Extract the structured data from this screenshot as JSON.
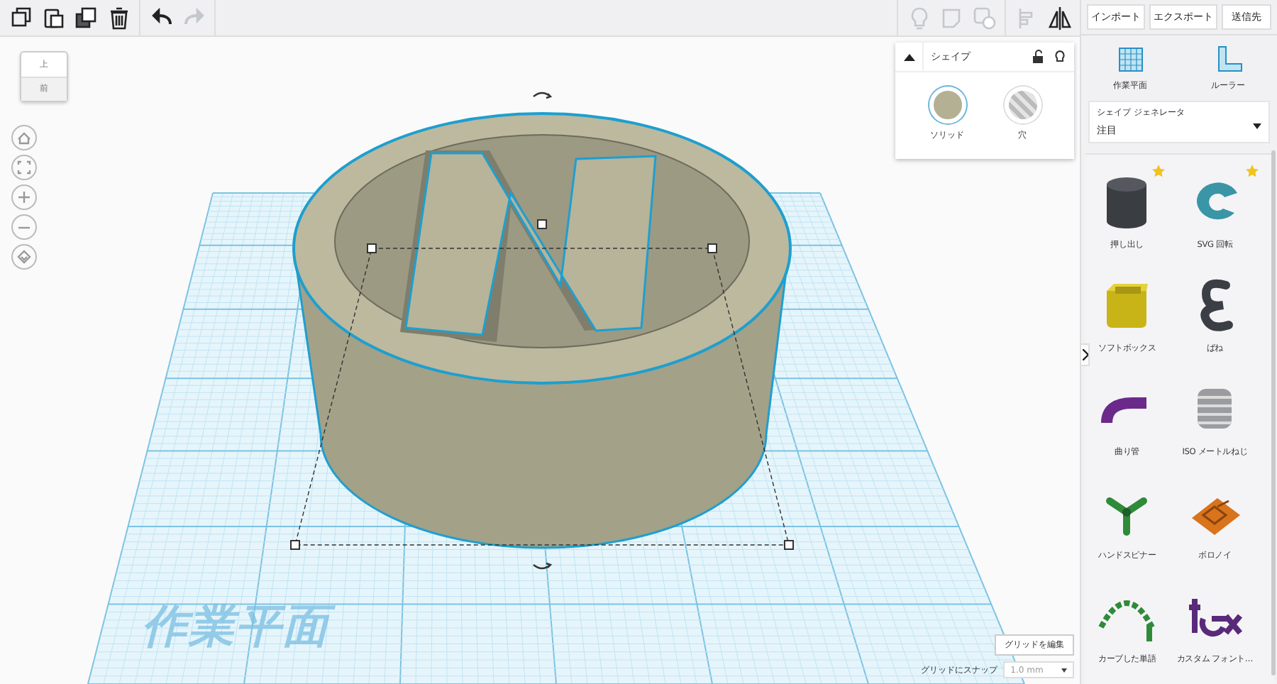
{
  "toolbar": {
    "left_tools": [
      {
        "kind": "copy",
        "disabled": false
      },
      {
        "kind": "paste",
        "disabled": false
      },
      {
        "kind": "duplicate",
        "disabled": false
      },
      {
        "kind": "delete",
        "disabled": false
      },
      {
        "kind": "undo",
        "disabled": false
      },
      {
        "kind": "redo",
        "disabled": true
      }
    ],
    "right_tools": [
      {
        "kind": "bulb",
        "disabled": true
      },
      {
        "kind": "note",
        "disabled": true
      },
      {
        "kind": "group",
        "disabled": true
      },
      {
        "kind": "align",
        "disabled": true
      },
      {
        "kind": "mirror",
        "disabled": false
      }
    ]
  },
  "header_buttons": [
    "インポート",
    "エクスポート",
    "送信先"
  ],
  "view_cube": {
    "top": "上",
    "front": "前"
  },
  "view_controls": [
    {
      "kind": "home"
    },
    {
      "kind": "fit"
    },
    {
      "kind": "zoom_in"
    },
    {
      "kind": "zoom_out"
    },
    {
      "kind": "ortho"
    }
  ],
  "shape_panel": {
    "title": "シェイプ",
    "options": [
      {
        "label": "ソリッド",
        "kind": "solid",
        "selected": true
      },
      {
        "label": "穴",
        "kind": "hole",
        "selected": false
      }
    ]
  },
  "workplane": {
    "label": "作業平面"
  },
  "edit_grid_button": "グリッドを編集",
  "snap": {
    "label": "グリッドにスナップ",
    "value": "1.0 mm"
  },
  "side_tools": [
    {
      "label": "作業平面",
      "kind": "workplane"
    },
    {
      "label": "ルーラー",
      "kind": "ruler"
    }
  ],
  "generator": {
    "label": "シェイプ ジェネレータ",
    "value": "注目"
  },
  "shapes": [
    {
      "label": "押し出し",
      "kind": "extrude",
      "starred": true
    },
    {
      "label": "SVG 回転",
      "kind": "svg_revolve",
      "starred": true
    },
    {
      "label": "ソフトボックス",
      "kind": "softbox",
      "starred": false
    },
    {
      "label": "ばね",
      "kind": "spring",
      "starred": false
    },
    {
      "label": "曲り管",
      "kind": "pipe",
      "starred": false
    },
    {
      "label": "ISO メートルねじ",
      "kind": "screw",
      "starred": false
    },
    {
      "label": "ハンドスピナー",
      "kind": "spinner",
      "starred": false
    },
    {
      "label": "ボロノイ",
      "kind": "voronoi",
      "starred": false
    },
    {
      "label": "カーブした単語",
      "kind": "curved_word",
      "starred": false
    },
    {
      "label": "カスタム フォント…",
      "kind": "custom_font",
      "starred": false
    }
  ]
}
